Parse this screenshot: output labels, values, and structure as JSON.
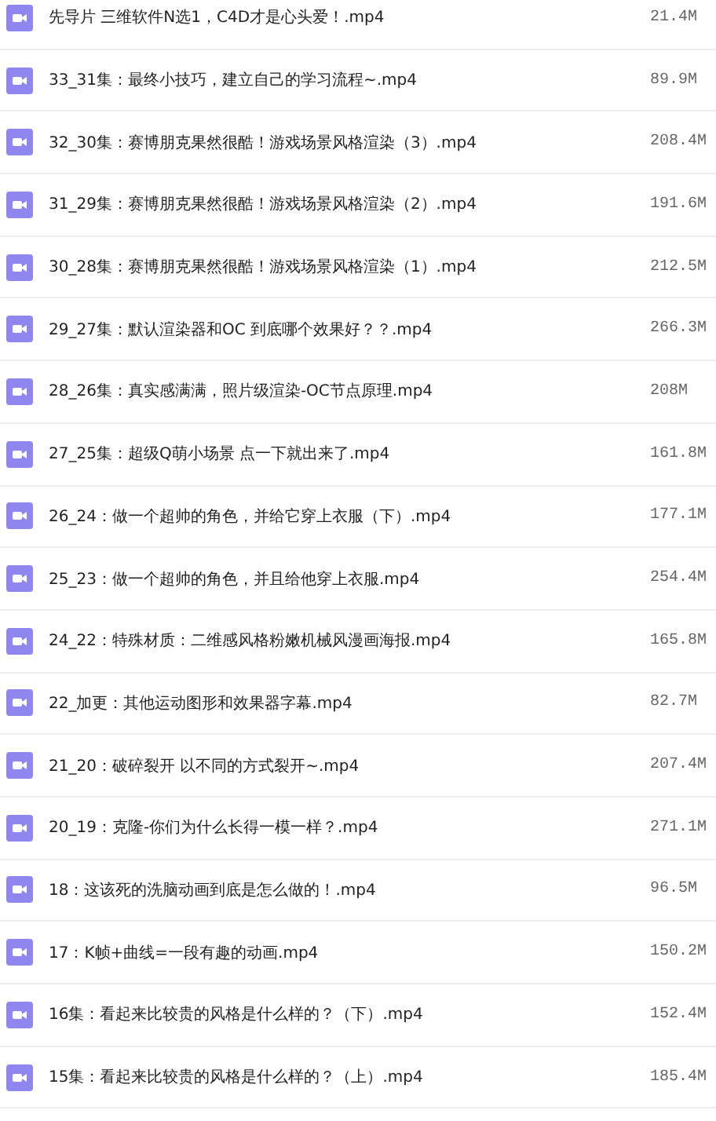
{
  "files": [
    {
      "name": "先导片 三维软件N选1，C4D才是心头爱！.mp4",
      "size": "21.4M"
    },
    {
      "name": "33_31集：最终小技巧，建立自己的学习流程~.mp4",
      "size": "89.9M"
    },
    {
      "name": "32_30集：赛博朋克果然很酷！游戏场景风格渲染（3）.mp4",
      "size": "208.4M"
    },
    {
      "name": "31_29集：赛博朋克果然很酷！游戏场景风格渲染（2）.mp4",
      "size": "191.6M"
    },
    {
      "name": "30_28集：赛博朋克果然很酷！游戏场景风格渲染（1）.mp4",
      "size": "212.5M"
    },
    {
      "name": "29_27集：默认渲染器和OC 到底哪个效果好？？.mp4",
      "size": "266.3M"
    },
    {
      "name": "28_26集：真实感满满，照片级渲染-OC节点原理.mp4",
      "size": "208M"
    },
    {
      "name": "27_25集：超级Q萌小场景 点一下就出来了.mp4",
      "size": "161.8M"
    },
    {
      "name": "26_24：做一个超帅的角色，并给它穿上衣服（下）.mp4",
      "size": "177.1M"
    },
    {
      "name": "25_23：做一个超帅的角色，并且给他穿上衣服.mp4",
      "size": "254.4M"
    },
    {
      "name": "24_22：特殊材质：二维感风格粉嫩机械风漫画海报.mp4",
      "size": "165.8M"
    },
    {
      "name": "22_加更：其他运动图形和效果器字幕.mp4",
      "size": "82.7M"
    },
    {
      "name": "21_20：破碎裂开 以不同的方式裂开~.mp4",
      "size": "207.4M"
    },
    {
      "name": "20_19：克隆-你们为什么长得一模一样？.mp4",
      "size": "271.1M"
    },
    {
      "name": "18：这该死的洗脑动画到底是怎么做的！.mp4",
      "size": "96.5M"
    },
    {
      "name": "17：K帧+曲线=一段有趣的动画.mp4",
      "size": "150.2M"
    },
    {
      "name": "16集：看起来比较贵的风格是什么样的？（下）.mp4",
      "size": "152.4M"
    },
    {
      "name": "15集：看起来比较贵的风格是什么样的？（上）.mp4",
      "size": "185.4M"
    }
  ]
}
